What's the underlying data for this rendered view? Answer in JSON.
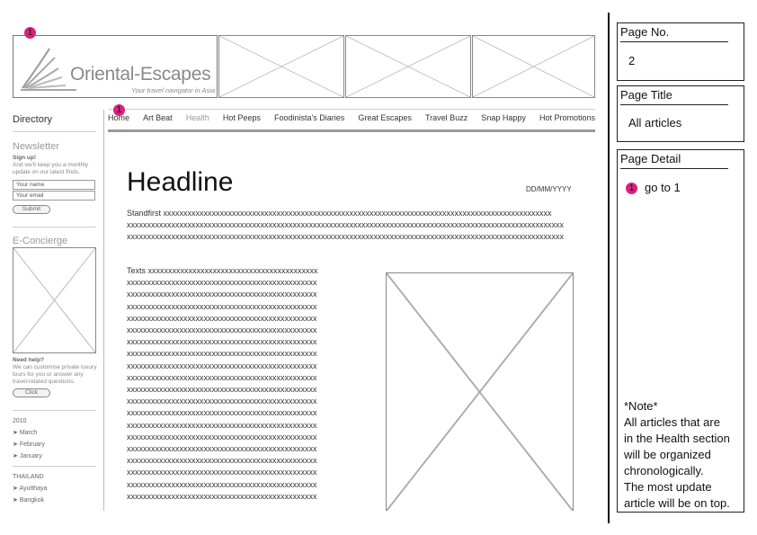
{
  "logo": {
    "name": "Oriental-Escapes",
    "tagline": "Your travel navigator in Asia",
    "marker": "1"
  },
  "nav": {
    "marker": "1",
    "items": [
      "Home",
      "Art Beat",
      "Health",
      "Hot Peeps",
      "Foodinista's Diaries",
      "Great Escapes",
      "Travel Buzz",
      "Snap Happy",
      "Hot Promotions"
    ]
  },
  "sidebar": {
    "directory": "Directory",
    "newsletter": {
      "title": "Newsletter",
      "signup": "Sign up!",
      "desc": "And we'll keep you a monthly update on our latest finds.",
      "name_placeholder": "Your name",
      "email_placeholder": "Your email",
      "submit": "Submit"
    },
    "econcierge": {
      "title": "E-Concierge",
      "help_title": "Need help?",
      "help_desc": "We can customise private luxury tours for you or answer any travel-related questions.",
      "click": "Click"
    },
    "archive": {
      "year": "2010",
      "months": [
        "March",
        "February",
        "January"
      ]
    },
    "country": {
      "title": "THAILAND",
      "places": [
        "Ayutthaya",
        "Bangkok"
      ]
    }
  },
  "article": {
    "headline": "Headline",
    "date": "DD/MM/YYYY",
    "standfirst": [
      "Standfirst xxxxxxxxxxxxxxxxxxxxxxxxxxxxxxxxxxxxxxxxxxxxxxxxxxxxxxxxxxxxxxxxxxxxxxxxxxxxxxxxxxxxxxxxxxxxxxxx",
      "xxxxxxxxxxxxxxxxxxxxxxxxxxxxxxxxxxxxxxxxxxxxxxxxxxxxxxxxxxxxxxxxxxxxxxxxxxxxxxxxxxxxxxxxxxxxxxxxxxxxxxxxxxxx",
      "xxxxxxxxxxxxxxxxxxxxxxxxxxxxxxxxxxxxxxxxxxxxxxxxxxxxxxxxxxxxxxxxxxxxxxxxxxxxxxxxxxxxxxxxxxxxxxxxxxxxxxxxxxxx"
    ],
    "texts": [
      "Texts xxxxxxxxxxxxxxxxxxxxxxxxxxxxxxxxxxxxxxxxxx",
      "xxxxxxxxxxxxxxxxxxxxxxxxxxxxxxxxxxxxxxxxxxxxxxx",
      "xxxxxxxxxxxxxxxxxxxxxxxxxxxxxxxxxxxxxxxxxxxxxxx",
      "xxxxxxxxxxxxxxxxxxxxxxxxxxxxxxxxxxxxxxxxxxxxxxx",
      "xxxxxxxxxxxxxxxxxxxxxxxxxxxxxxxxxxxxxxxxxxxxxxx",
      "xxxxxxxxxxxxxxxxxxxxxxxxxxxxxxxxxxxxxxxxxxxxxxx",
      "xxxxxxxxxxxxxxxxxxxxxxxxxxxxxxxxxxxxxxxxxxxxxxx",
      "xxxxxxxxxxxxxxxxxxxxxxxxxxxxxxxxxxxxxxxxxxxxxxx",
      "xxxxxxxxxxxxxxxxxxxxxxxxxxxxxxxxxxxxxxxxxxxxxxx",
      "xxxxxxxxxxxxxxxxxxxxxxxxxxxxxxxxxxxxxxxxxxxxxxx",
      "xxxxxxxxxxxxxxxxxxxxxxxxxxxxxxxxxxxxxxxxxxxxxxx",
      "xxxxxxxxxxxxxxxxxxxxxxxxxxxxxxxxxxxxxxxxxxxxxxx",
      "xxxxxxxxxxxxxxxxxxxxxxxxxxxxxxxxxxxxxxxxxxxxxxx",
      "xxxxxxxxxxxxxxxxxxxxxxxxxxxxxxxxxxxxxxxxxxxxxxx",
      "xxxxxxxxxxxxxxxxxxxxxxxxxxxxxxxxxxxxxxxxxxxxxxx",
      "xxxxxxxxxxxxxxxxxxxxxxxxxxxxxxxxxxxxxxxxxxxxxxx",
      "xxxxxxxxxxxxxxxxxxxxxxxxxxxxxxxxxxxxxxxxxxxxxxx",
      "xxxxxxxxxxxxxxxxxxxxxxxxxxxxxxxxxxxxxxxxxxxxxxx",
      "xxxxxxxxxxxxxxxxxxxxxxxxxxxxxxxxxxxxxxxxxxxxxxx",
      "xxxxxxxxxxxxxxxxxxxxxxxxxxxxxxxxxxxxxxxxxxxxxxx"
    ]
  },
  "panel": {
    "page_no_label": "Page No.",
    "page_no": "2",
    "page_title_label": "Page Title",
    "page_title": "All articles",
    "page_detail_label": "Page Detail",
    "detail_marker": "1",
    "detail_text": "go to 1",
    "note_lines": [
      "*Note*",
      "All articles that are",
      "in the Health section",
      "will be organized",
      "chronologically.",
      "The most update",
      "article will be on top."
    ]
  }
}
